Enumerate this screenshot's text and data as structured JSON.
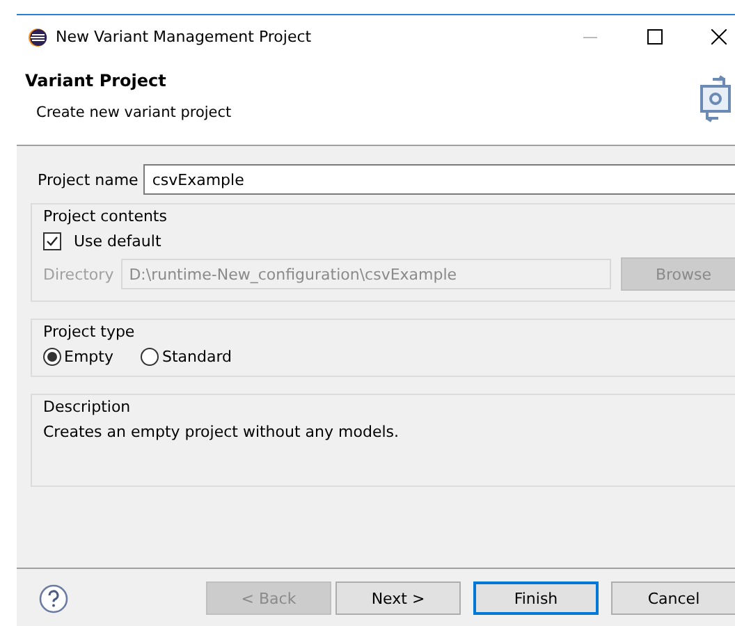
{
  "window": {
    "title": "New Variant Management Project"
  },
  "header": {
    "title": "Variant Project",
    "subtitle": "Create new variant project"
  },
  "project_name": {
    "label": "Project name",
    "value": "csvExample"
  },
  "project_contents": {
    "title": "Project contents",
    "use_default": {
      "label": "Use default",
      "checked": true
    },
    "directory": {
      "label": "Directory",
      "value": "D:\\runtime-New_configuration\\csvExample",
      "disabled": true
    },
    "browse": {
      "label": "Browse",
      "disabled": true
    }
  },
  "project_type": {
    "title": "Project type",
    "options": [
      {
        "label": "Empty",
        "selected": true
      },
      {
        "label": "Standard",
        "selected": false
      }
    ]
  },
  "description": {
    "title": "Description",
    "text": "Creates an empty project without any models."
  },
  "buttons": [
    {
      "label": "< Back",
      "disabled": true,
      "default": false
    },
    {
      "label": "Next >",
      "disabled": false,
      "default": false
    },
    {
      "label": "Finish",
      "disabled": false,
      "default": true
    },
    {
      "label": "Cancel",
      "disabled": false,
      "default": false
    }
  ]
}
